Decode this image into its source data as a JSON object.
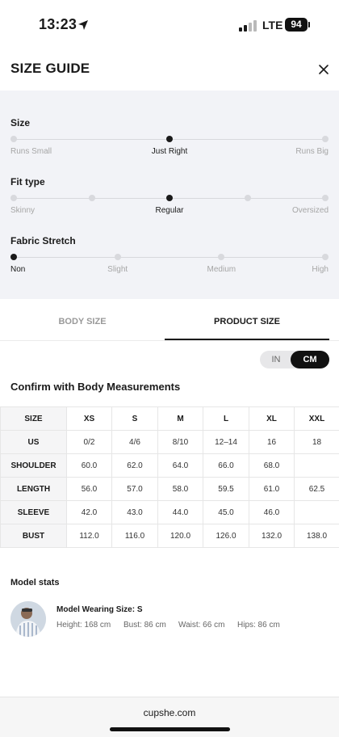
{
  "status_bar": {
    "time": "13:23",
    "network": "LTE",
    "battery": "94"
  },
  "header": {
    "title": "SIZE GUIDE"
  },
  "fit": {
    "size": {
      "title": "Size",
      "steps": 3,
      "selected_index": 1,
      "labels": [
        "Runs Small",
        "Just Right",
        "Runs Big"
      ]
    },
    "fit_type": {
      "title": "Fit type",
      "steps": 5,
      "selected_index": 2,
      "labels": [
        "Skinny",
        "Regular",
        "Oversized"
      ]
    },
    "fabric_stretch": {
      "title": "Fabric Stretch",
      "steps": 4,
      "selected_index": 0,
      "labels": [
        "Non",
        "Slight",
        "Medium",
        "High"
      ]
    }
  },
  "tabs": [
    {
      "label": "BODY SIZE",
      "active": false
    },
    {
      "label": "PRODUCT SIZE",
      "active": true
    }
  ],
  "unit_toggle": {
    "in_label": "IN",
    "cm_label": "CM",
    "selected": "CM"
  },
  "confirm_title": "Confirm with Body Measurements",
  "size_table": {
    "header": [
      "SIZE",
      "XS",
      "S",
      "M",
      "L",
      "XL",
      "XXL"
    ],
    "rows": [
      [
        "US",
        "0/2",
        "4/6",
        "8/10",
        "12–14",
        "16",
        "18"
      ],
      [
        "SHOULDER",
        "60.0",
        "62.0",
        "64.0",
        "66.0",
        "68.0",
        ""
      ],
      [
        "LENGTH",
        "56.0",
        "57.0",
        "58.0",
        "59.5",
        "61.0",
        "62.5"
      ],
      [
        "SLEEVE",
        "42.0",
        "43.0",
        "44.0",
        "45.0",
        "46.0",
        ""
      ],
      [
        "BUST",
        "112.0",
        "116.0",
        "120.0",
        "126.0",
        "132.0",
        "138.0"
      ]
    ]
  },
  "model": {
    "title": "Model stats",
    "wearing_size": "Model Wearing Size: S",
    "height": "Height: 168 cm",
    "bust": "Bust: 86 cm",
    "waist": "Waist: 66 cm",
    "hips": "Hips: 86 cm"
  },
  "browser": {
    "url": "cupshe.com"
  }
}
